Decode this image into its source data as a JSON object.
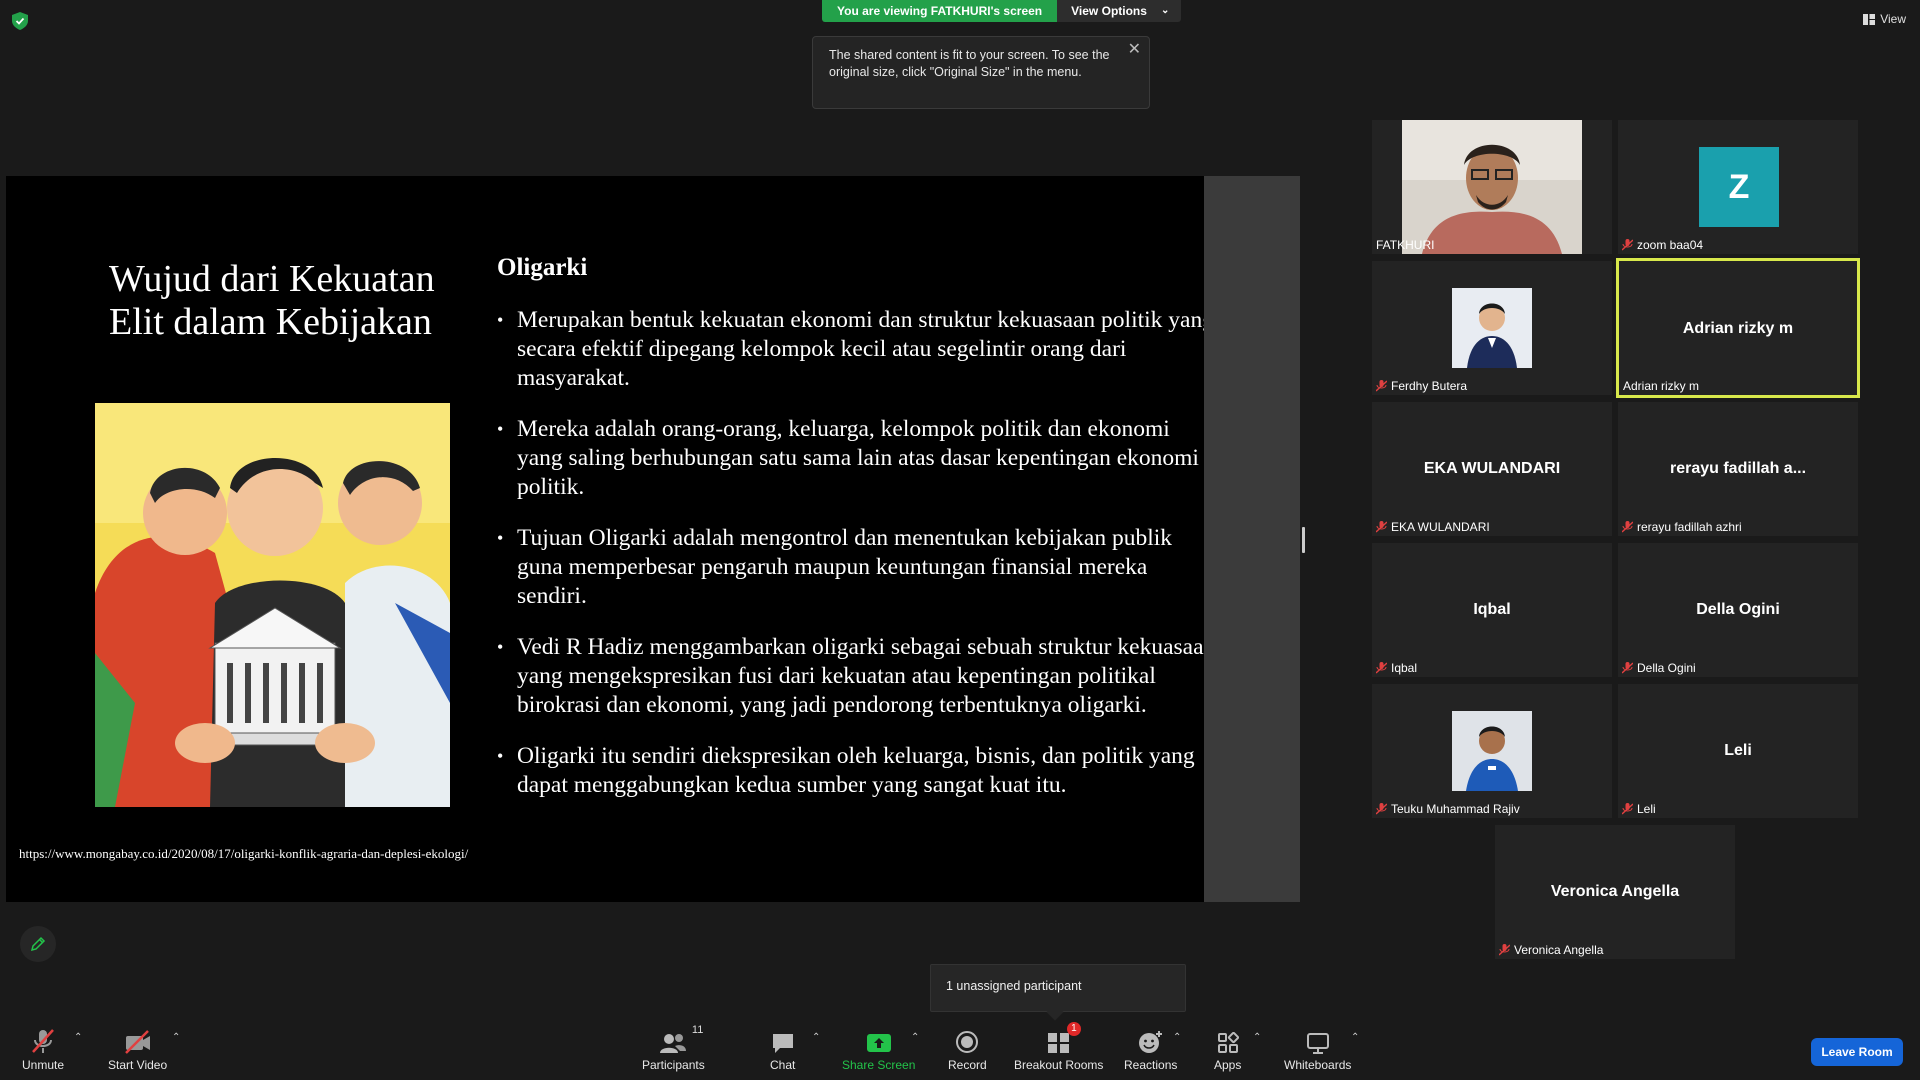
{
  "top": {
    "viewing_label": "You are viewing FATKHURI's screen",
    "view_options_label": "View Options",
    "tooltip_text": "The shared content is fit to your screen. To see the original size, click \"Original Size\" in the menu.",
    "view_label": "View"
  },
  "slide": {
    "title": "Wujud dari Kekuatan Elit dalam Kebijakan",
    "heading": "Oligarki",
    "bullets": [
      "Merupakan bentuk kekuatan ekonomi dan struktur kekuasaan politik yang secara efektif dipegang kelompok kecil atau segelintir orang dari masyarakat.",
      "Mereka adalah orang-orang, keluarga, kelompok politik dan ekonomi yang saling berhubungan satu sama lain atas dasar kepentingan ekonomi politik.",
      "Tujuan Oligarki adalah mengontrol dan menentukan kebijakan publik guna memperbesar pengaruh maupun keuntungan finansial mereka sendiri.",
      "Vedi R Hadiz menggambarkan oligarki sebagai sebuah struktur kekuasaan yang mengekspresikan fusi dari kekuatan atau kepentingan politikal birokrasi dan ekonomi, yang jadi pendorong terbentuknya oligarki.",
      "Oligarki itu sendiri diekspresikan oleh keluarga, bisnis, dan politik yang dapat menggabungkan  kedua sumber yang sangat kuat itu."
    ],
    "url": "https://www.mongabay.co.id/2020/08/17/oligarki-konflik-agraria-dan-deplesi-ekologi/"
  },
  "participants": [
    {
      "name": "FATKHURI",
      "display": "",
      "type": "photo"
    },
    {
      "name": "zoom baa04",
      "display": "Z",
      "type": "initial"
    },
    {
      "name": "Ferdhy Butera",
      "display": "",
      "type": "photo"
    },
    {
      "name": "Adrian rizky m",
      "display": "Adrian rizky m",
      "type": "text"
    },
    {
      "name": "EKA WULANDARI",
      "display": "EKA WULANDARI",
      "type": "text"
    },
    {
      "name": "rerayu fadillah azhri",
      "display": "rerayu fadillah a...",
      "type": "text"
    },
    {
      "name": "Iqbal",
      "display": "Iqbal",
      "type": "text"
    },
    {
      "name": "Della Ogini",
      "display": "Della Ogini",
      "type": "text"
    },
    {
      "name": "Teuku Muhammad Rajiv",
      "display": "",
      "type": "photo"
    },
    {
      "name": "Leli",
      "display": "Leli",
      "type": "text"
    },
    {
      "name": "Veronica Angella",
      "display": "Veronica Angella",
      "type": "text"
    }
  ],
  "unassigned_text": "1 unassigned participant",
  "toolbar": {
    "unmute": "Unmute",
    "start_video": "Start Video",
    "participants": "Participants",
    "participants_count": "11",
    "chat": "Chat",
    "share_screen": "Share Screen",
    "record": "Record",
    "breakout_rooms": "Breakout Rooms",
    "breakout_badge": "1",
    "reactions": "Reactions",
    "apps": "Apps",
    "whiteboards": "Whiteboards",
    "leave_room": "Leave Room"
  },
  "colors": {
    "green": "#23a14a",
    "active_border": "#d8e84b",
    "avatar_teal": "#1aa0ad",
    "leave_blue": "#1565d8"
  }
}
